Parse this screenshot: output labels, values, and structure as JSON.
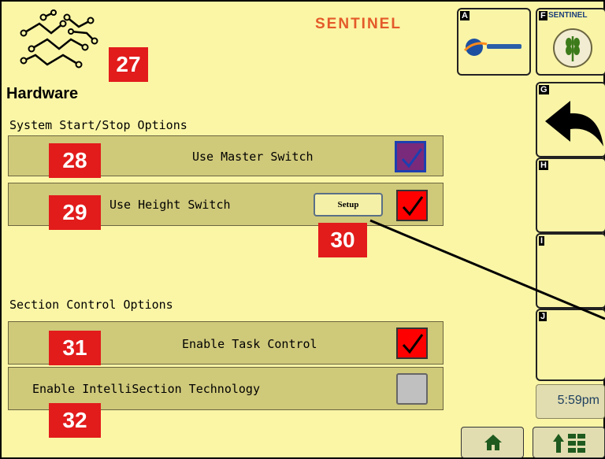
{
  "header": {
    "brand": "SENTINEL"
  },
  "page": {
    "title": "Hardware"
  },
  "callouts": {
    "c27": "27",
    "c28": "28",
    "c29": "29",
    "c30": "30",
    "c31": "31",
    "c32": "32"
  },
  "sections": {
    "system": {
      "title": "System Start/Stop Options",
      "master_label": "Use Master Switch",
      "master_checked": true,
      "height_label": "Use Height Switch",
      "height_checked": true,
      "setup_label": "Setup"
    },
    "section_control": {
      "title": "Section Control Options",
      "task_label": "Enable Task Control",
      "task_checked": true,
      "intelli_label": "Enable IntelliSection Technology",
      "intelli_checked": false
    }
  },
  "softkeys": {
    "a": {
      "letter": "A"
    },
    "f": {
      "letter": "F",
      "text": "SENTINEL"
    },
    "g": {
      "letter": "G"
    },
    "h": {
      "letter": "H"
    },
    "i": {
      "letter": "I"
    },
    "j": {
      "letter": "J"
    }
  },
  "status": {
    "time": "5:59pm"
  },
  "colors": {
    "background": "#fbf6a6",
    "row": "#cfc97a",
    "callout": "#e21b1b",
    "check_red": "#ff0000",
    "check_purple": "#7a2a7a"
  }
}
